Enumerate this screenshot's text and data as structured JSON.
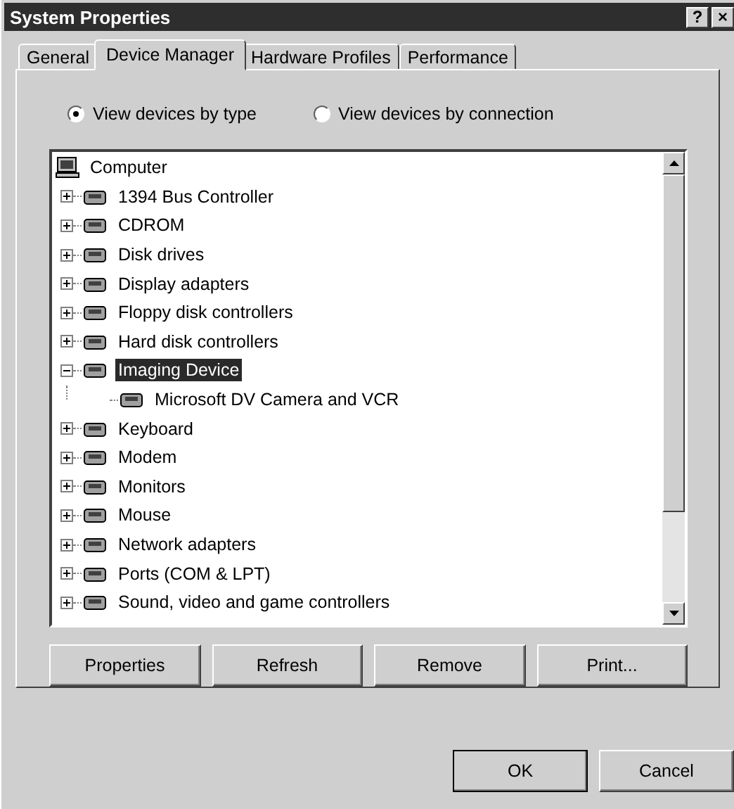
{
  "window": {
    "title": "System Properties",
    "title_buttons": [
      "?",
      "×"
    ]
  },
  "tabs": [
    {
      "label": "General",
      "selected": false
    },
    {
      "label": "Device Manager",
      "selected": true
    },
    {
      "label": "Hardware Profiles",
      "selected": false
    },
    {
      "label": "Performance",
      "selected": false
    }
  ],
  "view_options": [
    {
      "label": "View devices by type",
      "selected": true
    },
    {
      "label": "View devices by connection",
      "selected": false
    }
  ],
  "tree": [
    {
      "label": "Computer",
      "selected": false,
      "children": [
        {
          "label": "1394 Bus Controller",
          "expanded": false,
          "selected": false
        },
        {
          "label": "CDROM",
          "expanded": false,
          "selected": false
        },
        {
          "label": "Disk drives",
          "expanded": false,
          "selected": false
        },
        {
          "label": "Display adapters",
          "expanded": false,
          "selected": false
        },
        {
          "label": "Floppy disk controllers",
          "expanded": false,
          "selected": false
        },
        {
          "label": "Hard disk controllers",
          "expanded": false,
          "selected": false
        },
        {
          "label": "Imaging Device",
          "expanded": true,
          "selected": true,
          "children": [
            {
              "label": "Microsoft DV Camera and VCR",
              "selected": false
            }
          ]
        },
        {
          "label": "Keyboard",
          "expanded": false,
          "selected": false
        },
        {
          "label": "Modem",
          "expanded": false,
          "selected": false
        },
        {
          "label": "Monitors",
          "expanded": false,
          "selected": false
        },
        {
          "label": "Mouse",
          "expanded": false,
          "selected": false
        },
        {
          "label": "Network adapters",
          "expanded": false,
          "selected": false
        },
        {
          "label": "Ports (COM & LPT)",
          "expanded": false,
          "selected": false
        },
        {
          "label": "Sound, video and game controllers",
          "expanded": false,
          "selected": false
        }
      ]
    }
  ],
  "action_buttons": [
    "Properties",
    "Refresh",
    "Remove",
    "Print..."
  ],
  "dialog_buttons": [
    {
      "label": "OK",
      "default": true
    },
    {
      "label": "Cancel",
      "default": false
    }
  ]
}
